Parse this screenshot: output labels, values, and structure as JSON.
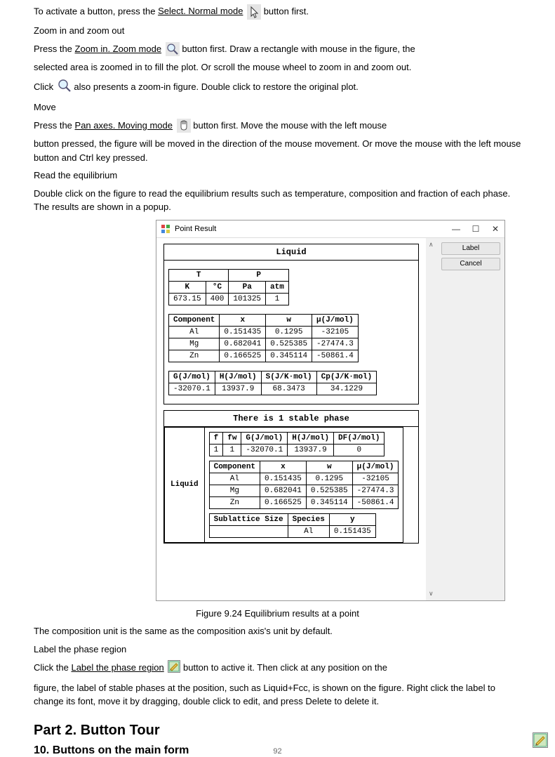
{
  "para1_pre": "To activate a button, press the ",
  "para1_link": "Select. Normal mode",
  "para1_post": " button first.",
  "para2": "Zoom in and zoom out",
  "para3_pre": "Press the ",
  "para3_link": "Zoom in. Zoom mode",
  "para3_post": " button first. Draw a rectangle with mouse in the figure, the",
  "para4": "selected area is zoomed in to fill the plot. Or scroll the mouse wheel to zoom in and zoom out.",
  "para5_pre": "Click ",
  "para5_post": " also presents a zoom-in figure. Double click to restore the original plot.",
  "para6": "Move",
  "para7_pre": "Press the ",
  "para7_link": "Pan axes. Moving mode",
  "para7_post": " button first. Move the mouse with the left mouse",
  "para8": "button pressed, the figure will be moved in the direction of the mouse movement. Or move the mouse with the left mouse button and Ctrl key pressed.",
  "para9": "Read the equilibrium",
  "para10": "Double click on the figure to read the equilibrium results such as temperature, composition and fraction of each phase. The results are shown in a popup.",
  "window": {
    "title": "Point Result",
    "buttons": {
      "label": "Label",
      "cancel": "Cancel"
    }
  },
  "liquid": {
    "title": "Liquid",
    "tp_headers": [
      "T",
      "P"
    ],
    "tp_sub": [
      "K",
      "°C",
      "Pa",
      "atm"
    ],
    "tp_row": [
      "673.15",
      "400",
      "101325",
      "1"
    ],
    "comp_headers": [
      "Component",
      "x",
      "w",
      "µ(J/mol)"
    ],
    "comp_rows": [
      [
        "Al",
        "0.151435",
        "0.1295",
        "-32105"
      ],
      [
        "Mg",
        "0.682041",
        "0.525385",
        "-27474.3"
      ],
      [
        "Zn",
        "0.166525",
        "0.345114",
        "-50861.4"
      ]
    ],
    "thermo_headers": [
      "G(J/mol)",
      "H(J/mol)",
      "S(J/K·mol)",
      "Cp(J/K·mol)"
    ],
    "thermo_row": [
      "-32070.1",
      "13937.9",
      "68.3473",
      "34.1229"
    ]
  },
  "stable": {
    "title": "There is 1 stable phase",
    "phase_label": "Liquid",
    "f_headers": [
      "f",
      "fw",
      "G(J/mol)",
      "H(J/mol)",
      "DF(J/mol)"
    ],
    "f_row": [
      "1",
      "1",
      "-32070.1",
      "13937.9",
      "0"
    ],
    "comp_headers": [
      "Component",
      "x",
      "w",
      "µ(J/mol)"
    ],
    "comp_rows": [
      [
        "Al",
        "0.151435",
        "0.1295",
        "-32105"
      ],
      [
        "Mg",
        "0.682041",
        "0.525385",
        "-27474.3"
      ],
      [
        "Zn",
        "0.166525",
        "0.345114",
        "-50861.4"
      ]
    ],
    "sub_headers": [
      "Sublattice Size",
      "Species",
      "y"
    ],
    "sub_rows": [
      [
        "",
        "Al",
        "0.151435"
      ]
    ]
  },
  "fig_caption": "Figure 9.24 Equilibrium results at a point",
  "para11": "The composition unit is the same as the composition axis's unit by default.",
  "para12": "Label the phase region",
  "para13_pre": "Click the ",
  "para13_link": "Label the phase region",
  "para13_post": " button to active it. Then click at any position on the",
  "para14": "figure, the label of stable phases at the position, such as Liquid+Fcc, is shown on the figure. Right click the label to change its font, move it by dragging, double click to edit, and press Delete to delete it.",
  "part2": "Part 2. Button Tour",
  "section10": "10.  Buttons on the main form",
  "page": "92"
}
